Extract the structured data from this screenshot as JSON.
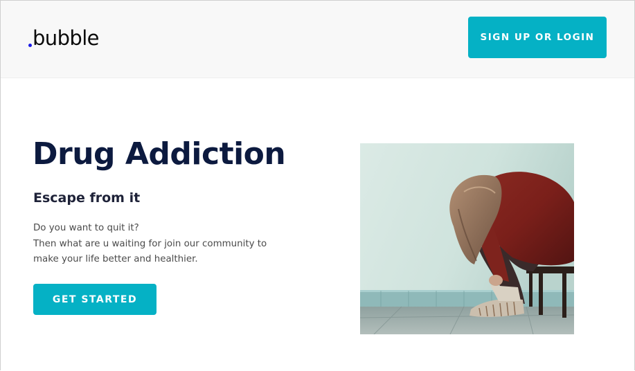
{
  "header": {
    "logo_text": "bubble",
    "login_button_label": "SIGN UP OR LOGIN"
  },
  "hero": {
    "title": "Drug Addiction",
    "subtitle": "Escape from it",
    "body_lines": [
      "Do you want to quit it?",
      "Then what are u waiting for join our community to",
      "make your life better and healthier."
    ],
    "cta_label": "GET STARTED",
    "image_alt": "person sitting hunched over on a chair against a wall"
  },
  "colors": {
    "accent": "#05b1c5",
    "title": "#0c1a3f",
    "logo_dot": "#1a1ae6"
  }
}
